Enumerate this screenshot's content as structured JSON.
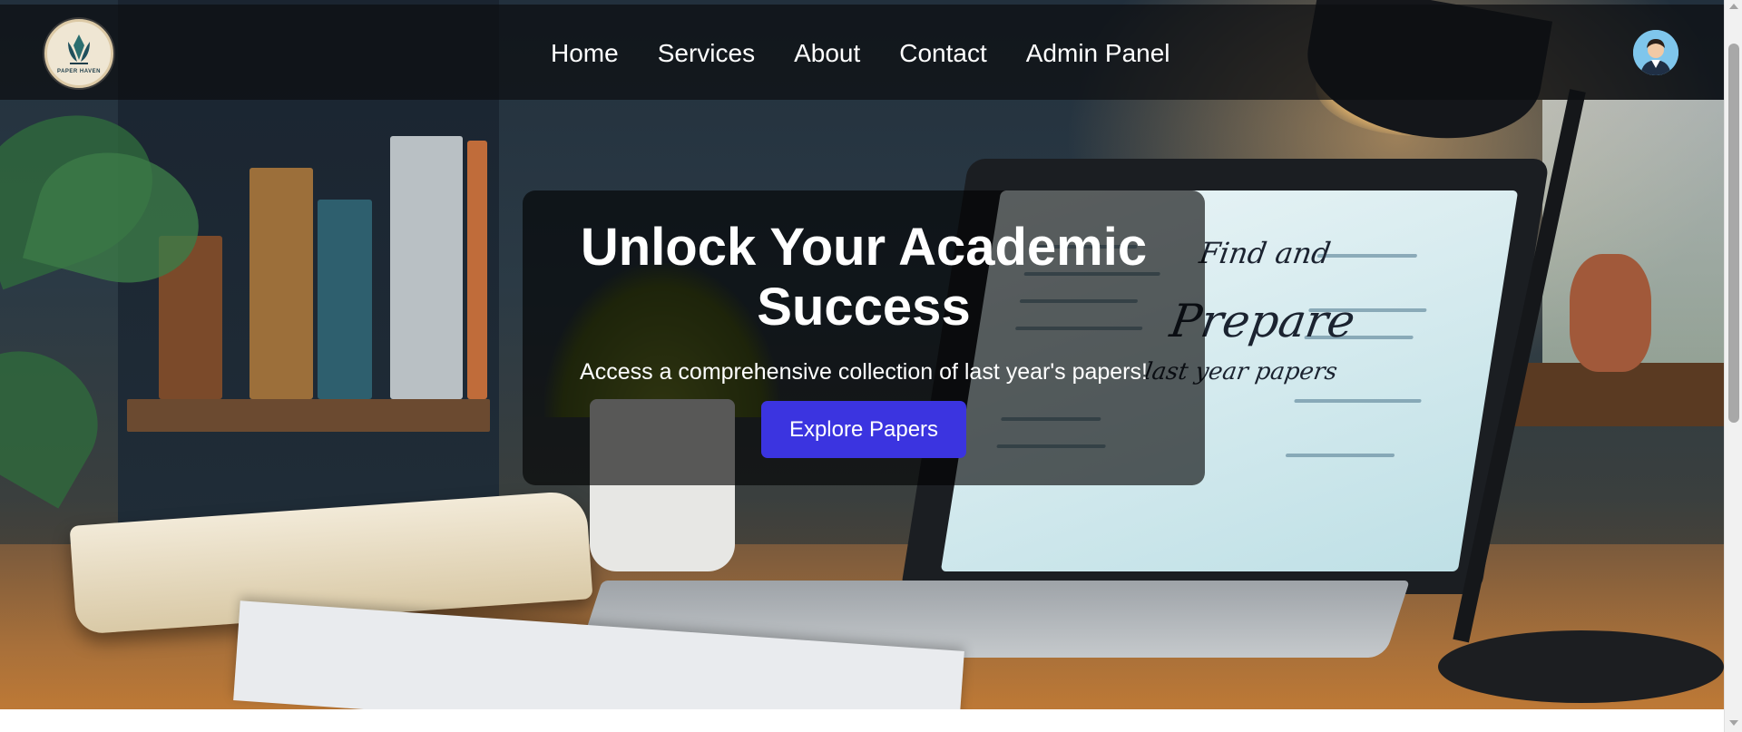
{
  "brand": {
    "logo_text": "PAPER HAVEN",
    "logo_icon": "leaf-emblem-icon"
  },
  "nav": {
    "links": [
      {
        "label": "Home"
      },
      {
        "label": "Services"
      },
      {
        "label": "About"
      },
      {
        "label": "Contact"
      },
      {
        "label": "Admin Panel"
      }
    ],
    "avatar_icon": "user-avatar-icon"
  },
  "hero": {
    "title": "Unlock Your Academic Success",
    "subtitle": "Access a comprehensive collection of last year's papers!",
    "cta_label": "Explore Papers",
    "screen_text": {
      "line1": "Find and",
      "line2": "Prepare",
      "line3": "last year papers"
    }
  },
  "colors": {
    "cta": "#3b34e0",
    "nav_bg": "rgba(12,14,16,0.72)",
    "text": "#ffffff"
  }
}
